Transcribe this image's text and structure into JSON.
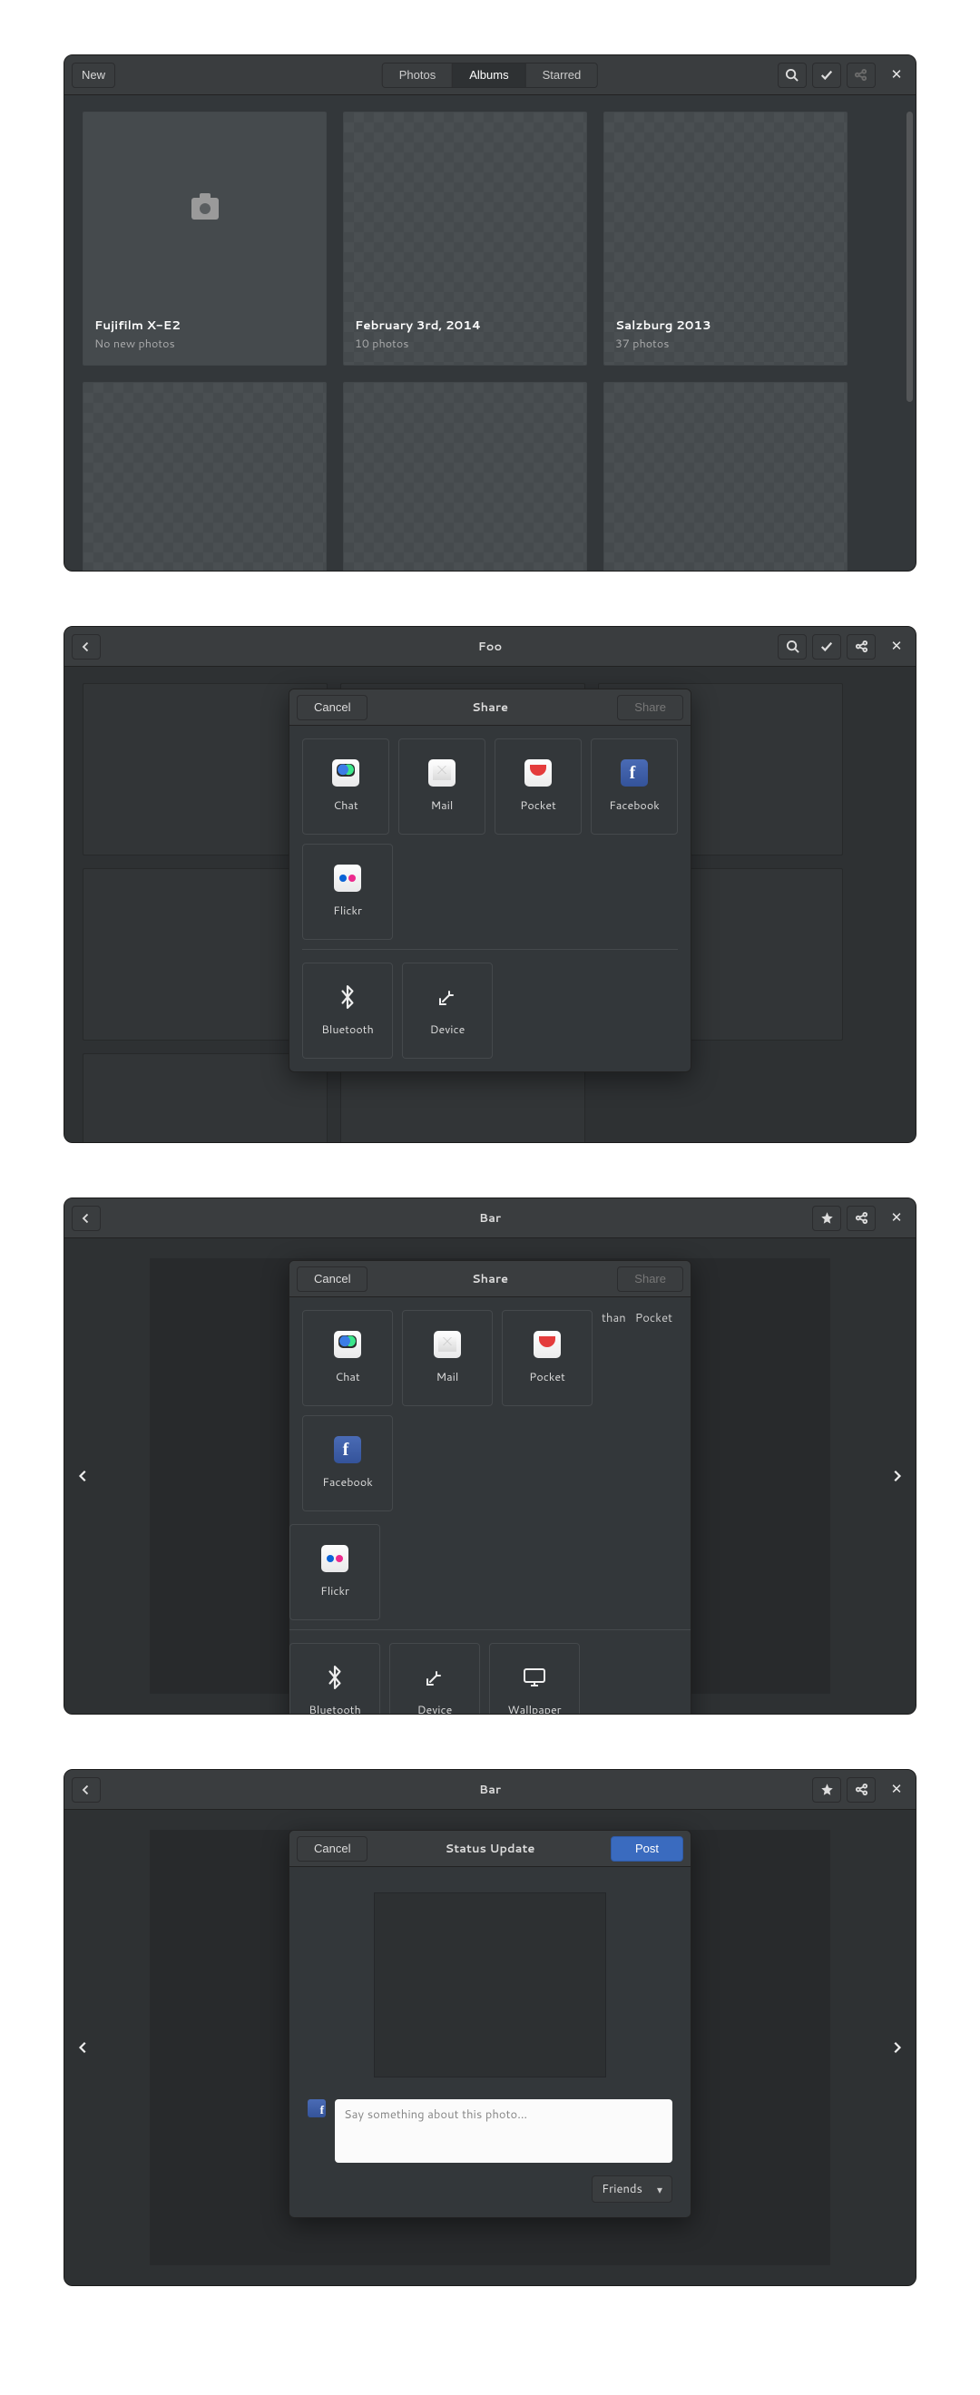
{
  "w1": {
    "header": {
      "new": "New",
      "tabs": {
        "photos": "Photos",
        "albums": "Albums",
        "starred": "Starred"
      },
      "active_tab": "albums"
    },
    "albums": [
      {
        "title": "Fujifilm X-E2",
        "sub": "No new photos",
        "plain": true,
        "camera": true
      },
      {
        "title": "February 3rd, 2014",
        "sub": "10 photos"
      },
      {
        "title": "Salzburg 2013",
        "sub": "37 photos"
      }
    ]
  },
  "w2": {
    "title": "Foo",
    "dialog": {
      "title": "Share",
      "cancel": "Cancel",
      "action": "Share",
      "apps": [
        {
          "l": "Chat",
          "k": "chat"
        },
        {
          "l": "Mail",
          "k": "mail"
        },
        {
          "l": "Pocket",
          "k": "pocket"
        },
        {
          "l": "Facebook",
          "k": "fb"
        },
        {
          "l": "Flickr",
          "k": "flickr"
        }
      ],
      "local": [
        {
          "l": "Bluetooth",
          "k": "bt"
        },
        {
          "l": "Device",
          "k": "dev"
        }
      ]
    }
  },
  "w3": {
    "title": "Bar",
    "dialog": {
      "title": "Share",
      "cancel": "Cancel",
      "action": "Share",
      "apps": [
        {
          "l": "Chat",
          "k": "chat"
        },
        {
          "l": "Mail",
          "k": "mail"
        },
        {
          "l": "Pocket",
          "k": "pocket"
        },
        {
          "l": "Facebook",
          "k": "fb"
        },
        {
          "l": "Flickr",
          "k": "flickr"
        }
      ],
      "local": [
        {
          "l": "Bluetooth",
          "k": "bt"
        },
        {
          "l": "Device",
          "k": "dev"
        },
        {
          "l": "Wallpaper",
          "k": "wall"
        }
      ]
    }
  },
  "w4": {
    "title": "Bar",
    "dialog": {
      "title": "Status Update",
      "cancel": "Cancel",
      "action": "Post",
      "placeholder": "Say something about this photo…",
      "audience": "Friends"
    }
  }
}
